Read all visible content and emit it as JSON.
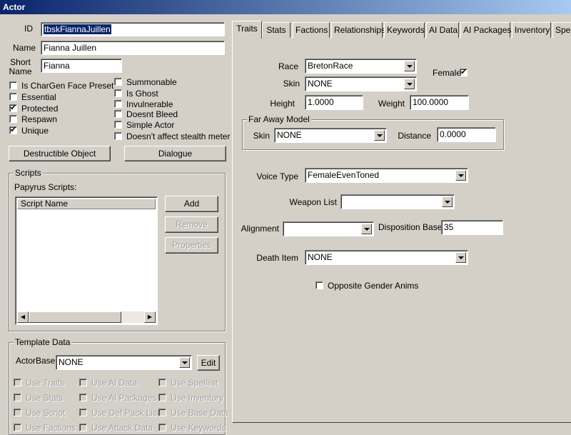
{
  "window": {
    "title": "Actor"
  },
  "left": {
    "id_label": "ID",
    "id_value": "tbskFiannaJuillen",
    "name_label": "Name",
    "name_value": "Fianna Juillen",
    "short_name_label_1": "Short",
    "short_name_label_2": "Name",
    "short_name_value": "Fianna",
    "checkboxes_left": [
      {
        "label": "Is CharGen Face Preset",
        "checked": ""
      },
      {
        "label": "Essential",
        "checked": ""
      },
      {
        "label": "Protected",
        "checked": "✔"
      },
      {
        "label": "Respawn",
        "checked": ""
      },
      {
        "label": "Unique",
        "checked": "✔"
      }
    ],
    "checkboxes_right": [
      {
        "label": "Summonable",
        "checked": ""
      },
      {
        "label": "Is Ghost",
        "checked": ""
      },
      {
        "label": "Invulnerable",
        "checked": ""
      },
      {
        "label": "Doesnt Bleed",
        "checked": ""
      },
      {
        "label": "Simple Actor",
        "checked": ""
      },
      {
        "label": "Doesn't affect stealth meter",
        "checked": ""
      }
    ],
    "destructible_button": "Destructible Object",
    "dialogue_button": "Dialogue"
  },
  "scripts": {
    "group_title": "Scripts",
    "papyrus_label": "Papyrus Scripts:",
    "column_header": "Script Name",
    "add_button": "Add",
    "remove_button": "Remove",
    "properties_button": "Properties"
  },
  "template": {
    "group_title": "Template Data",
    "actorbase_label": "ActorBase",
    "actorbase_value": "NONE",
    "edit_button": "Edit",
    "options": [
      [
        "Use Traits",
        "Use AI Data",
        "Use Spelllist"
      ],
      [
        "Use Stats",
        "Use AI Packages",
        "Use Inventory"
      ],
      [
        "Use Script",
        "Use Def Pack List",
        "Use Base Data"
      ],
      [
        "Use Factions",
        "Use Attack Data",
        "Use Keywords"
      ]
    ]
  },
  "tabs": [
    {
      "label": "Traits"
    },
    {
      "label": "Stats"
    },
    {
      "label": "Factions"
    },
    {
      "label": "Relationships"
    },
    {
      "label": "Keywords"
    },
    {
      "label": "AI Data"
    },
    {
      "label": "AI Packages"
    },
    {
      "label": "Inventory"
    },
    {
      "label": "Spel"
    }
  ],
  "traits": {
    "race_label": "Race",
    "race_value": "BretonRace",
    "female_label": "Female",
    "female_checked": "✔",
    "skin_label": "Skin",
    "skin_value": "NONE",
    "height_label": "Height",
    "height_value": "1.0000",
    "weight_label": "Weight",
    "weight_value": "100.0000",
    "far_away_title": "Far Away Model",
    "far_skin_label": "Skin",
    "far_skin_value": "NONE",
    "distance_label": "Distance",
    "distance_value": "0.0000",
    "voice_label": "Voice Type",
    "voice_value": "FemaleEvenToned",
    "weapon_list_label": "Weapon List",
    "weapon_list_value": "",
    "alignment_label": "Alignment",
    "alignment_value": "",
    "disposition_label": "Disposition Base",
    "disposition_value": "35",
    "death_item_label": "Death Item",
    "death_item_value": "NONE",
    "opposite_gender_label": "Opposite Gender Anims",
    "opposite_gender_checked": ""
  }
}
